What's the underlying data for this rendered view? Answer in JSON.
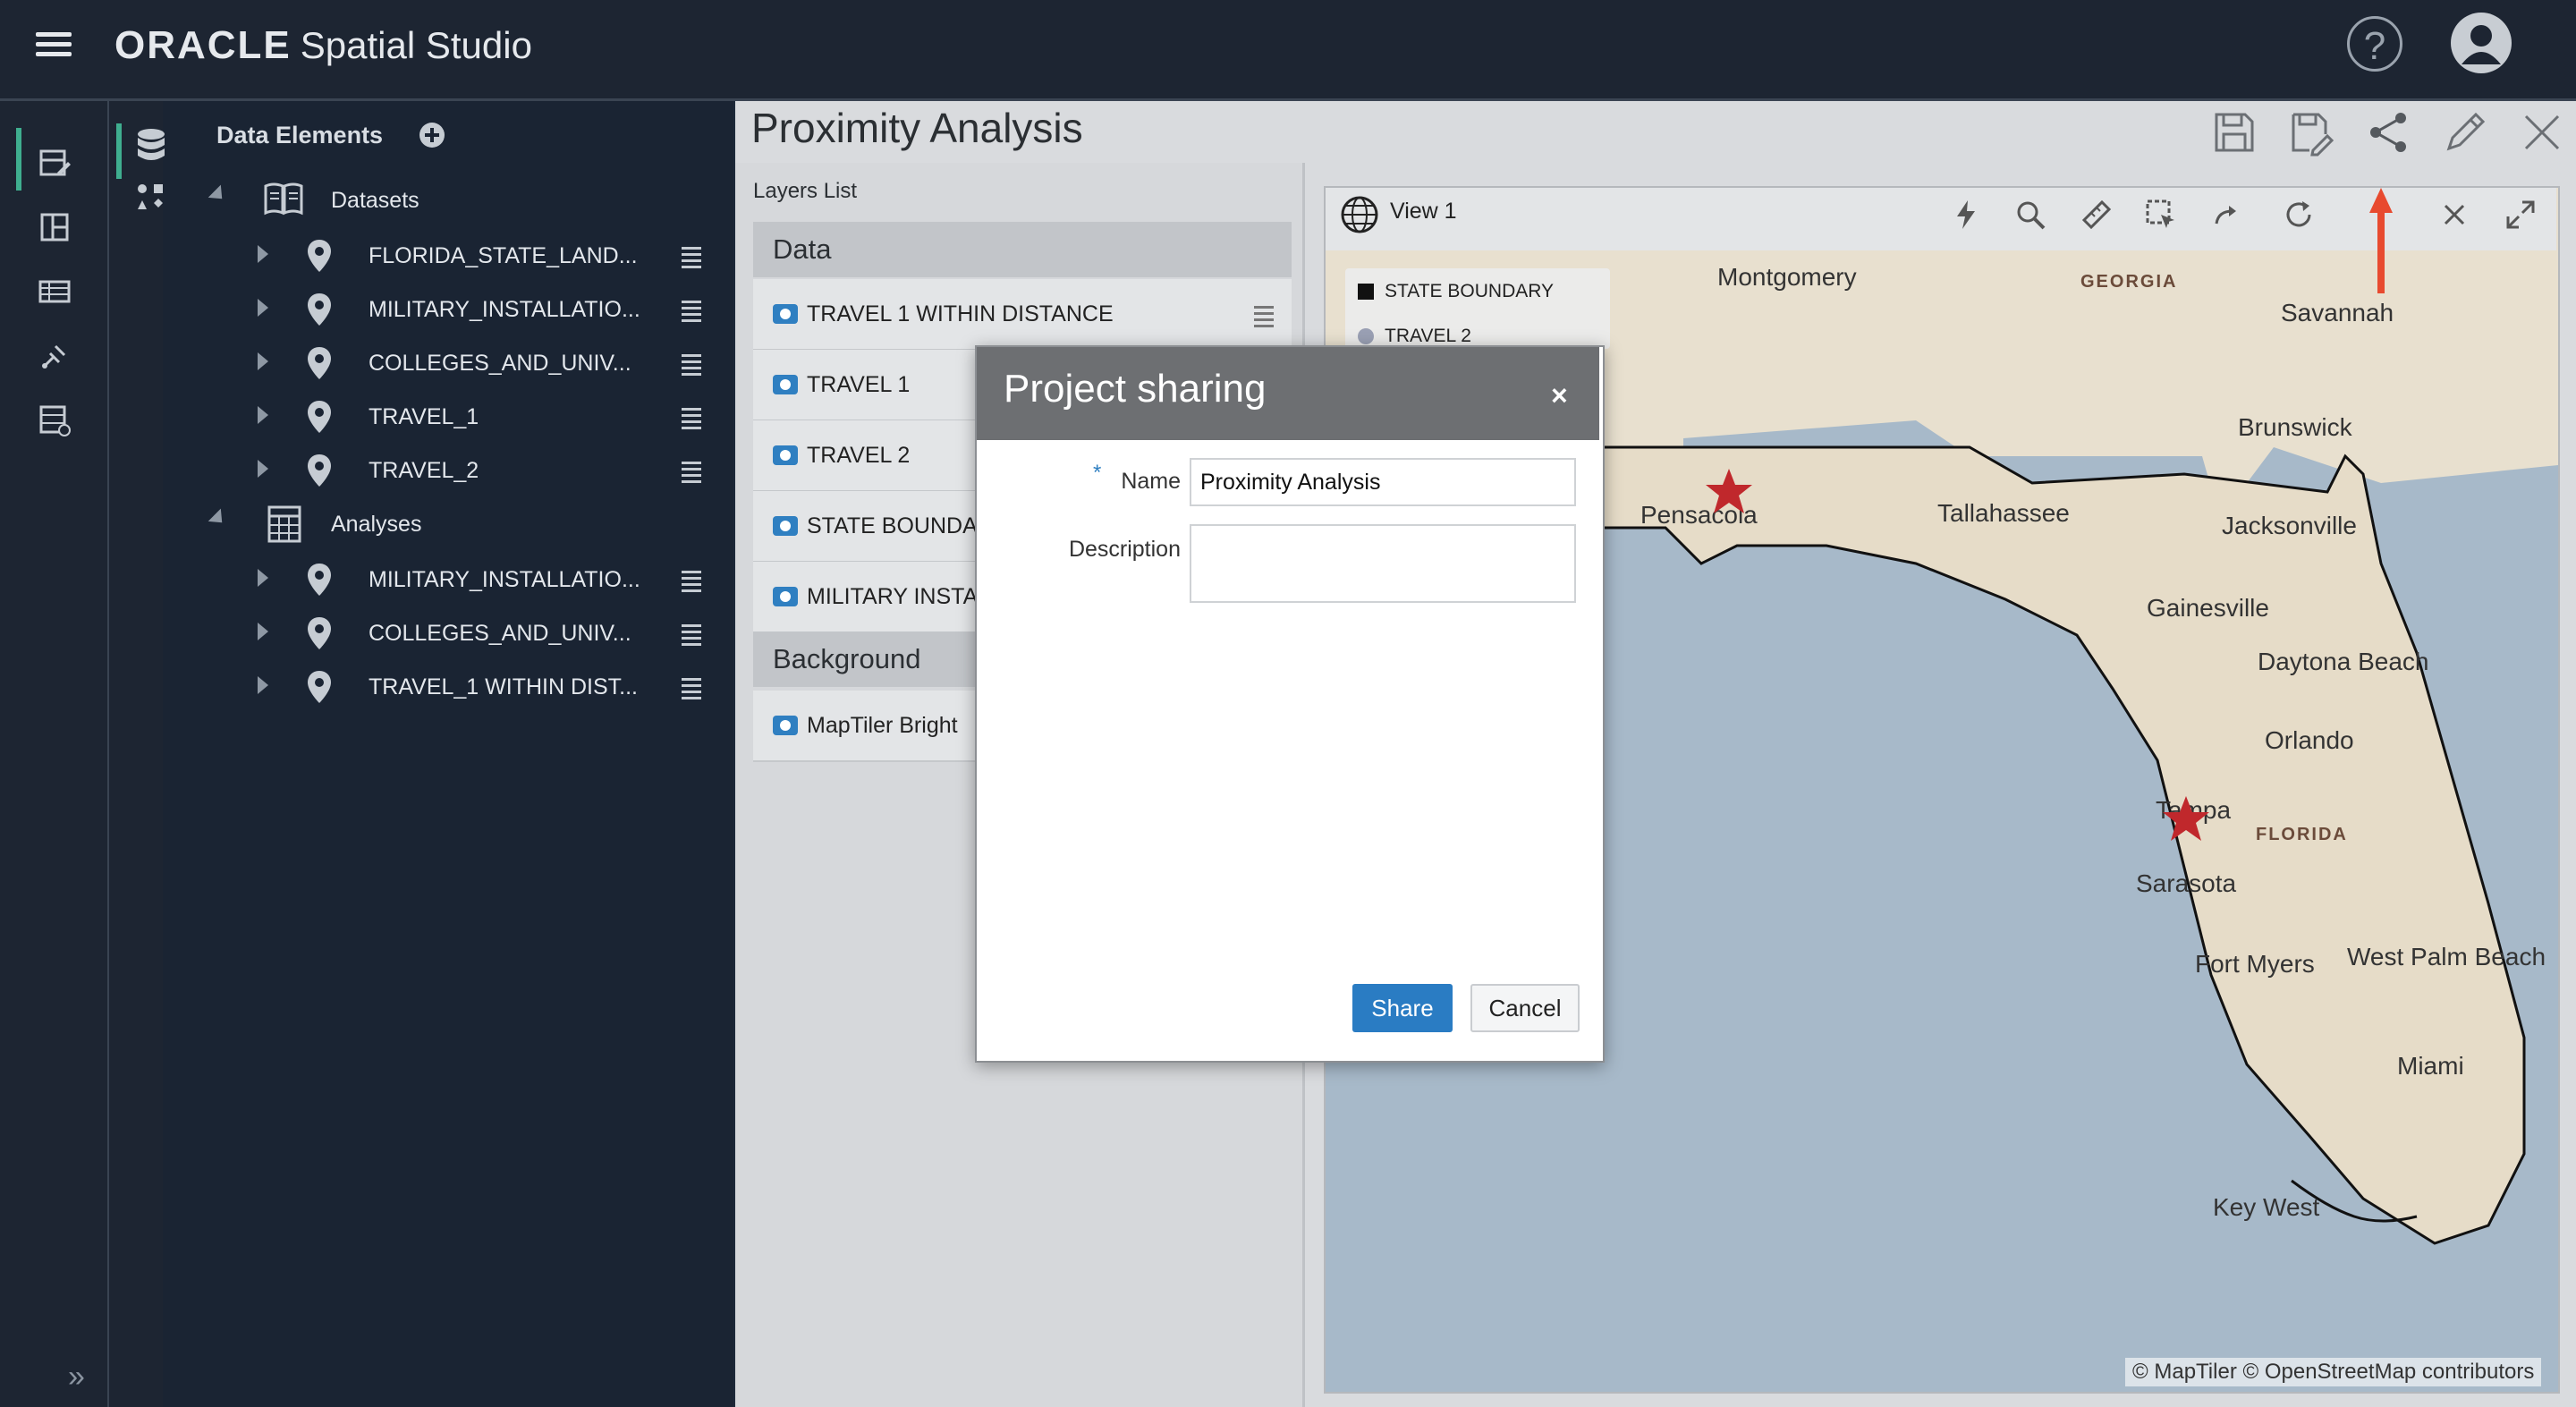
{
  "app": {
    "brand_company": "ORACLE",
    "brand_product": "Spatial Studio"
  },
  "data_panel": {
    "title": "Data Elements",
    "datasets_label": "Datasets",
    "datasets": [
      "FLORIDA_STATE_LAND...",
      "MILITARY_INSTALLATIO...",
      "COLLEGES_AND_UNIV...",
      "TRAVEL_1",
      "TRAVEL_2"
    ],
    "analyses_label": "Analyses",
    "analyses": [
      "MILITARY_INSTALLATIO...",
      "COLLEGES_AND_UNIV...",
      "TRAVEL_1 WITHIN DIST..."
    ]
  },
  "project": {
    "title": "Proximity Analysis"
  },
  "layers": {
    "list_label": "Layers List",
    "data_section": "Data",
    "data_layers": [
      "TRAVEL 1 WITHIN DISTANCE",
      "TRAVEL 1",
      "TRAVEL 2",
      "STATE BOUNDAR",
      "MILITARY INSTAL"
    ],
    "background_section": "Background",
    "background_layers": [
      "MapTiler Bright"
    ]
  },
  "map": {
    "view_label": "View 1",
    "legend": [
      "STATE BOUNDARY",
      "TRAVEL 2"
    ],
    "attribution": "© MapTiler  © OpenStreetMap contributors",
    "cities": {
      "montgomery": "Montgomery",
      "savannah": "Savannah",
      "brunswick": "Brunswick",
      "pensacola": "Pensacola",
      "tallahassee": "Tallahassee",
      "jacksonville": "Jacksonville",
      "gainesville": "Gainesville",
      "daytona": "Daytona Beach",
      "orlando": "Orlando",
      "tampa": "Tampa",
      "sarasota": "Sarasota",
      "fortmyers": "Fort Myers",
      "westpalm": "West Palm Beach",
      "miami": "Miami",
      "keywest": "Key West"
    },
    "regions": {
      "georgia": "GEORGIA",
      "florida": "FLORIDA"
    },
    "colors": {
      "accent_arrow": "#e84a2f",
      "star": "#c0282c",
      "land": "#e9e0cf",
      "water": "#a6b8c8"
    }
  },
  "modal": {
    "title": "Project sharing",
    "close_label": "×",
    "required_mark": "*",
    "name_label": "Name",
    "name_value": "Proximity Analysis",
    "description_label": "Description",
    "description_value": "",
    "share_label": "Share",
    "cancel_label": "Cancel"
  },
  "colors": {
    "topbar": "#1d2532",
    "primary_button": "#2a7cc3",
    "rail_active": "#3fae8f",
    "modal_header": "#6d6f72"
  }
}
